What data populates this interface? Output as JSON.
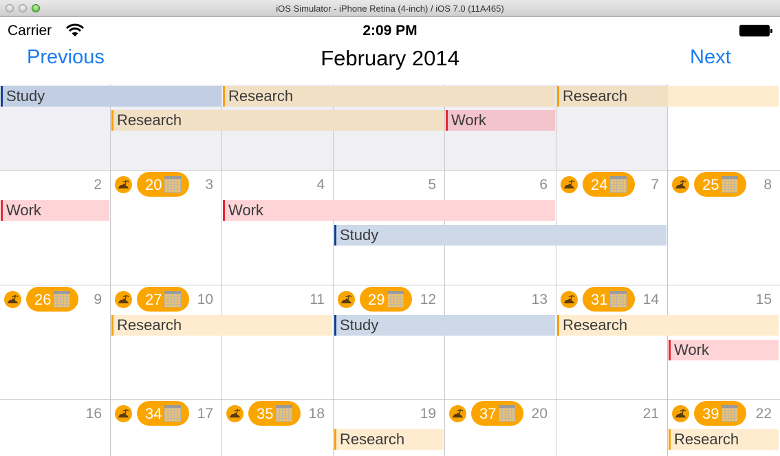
{
  "window": {
    "title": "iOS Simulator - iPhone Retina (4-inch) / iOS 7.0 (11A465)"
  },
  "status_bar": {
    "carrier": "Carrier",
    "time": "2:09 PM",
    "wifi_icon": "wifi-icon",
    "battery_icon": "battery-icon"
  },
  "nav": {
    "previous_label": "Previous",
    "title": "February 2014",
    "next_label": "Next"
  },
  "colors": {
    "accent": "#1a7cf0",
    "badge": "#fba500",
    "study": "#0c3e91",
    "research": "#f6a00f",
    "work": "#e8232e",
    "outside_month_bg": "#efeff4"
  },
  "weeks": [
    {
      "days": [
        {
          "num": "",
          "outside": true
        },
        {
          "num": "",
          "outside": true
        },
        {
          "num": "",
          "outside": true
        },
        {
          "num": "",
          "outside": true
        },
        {
          "num": "",
          "outside": true
        },
        {
          "num": "",
          "outside": true
        },
        {
          "num": "",
          "outside": false
        }
      ],
      "events": [
        {
          "label": "Study",
          "type": "study",
          "start": 0,
          "end": 1,
          "lane": 0,
          "segments_dim": [
            0,
            1
          ]
        },
        {
          "label": "Research",
          "type": "research",
          "start": 2,
          "end": 4,
          "lane": 0,
          "segments_dim": [
            2,
            3,
            4
          ]
        },
        {
          "label": "Research",
          "type": "research",
          "start": 5,
          "end": 6,
          "lane": 0,
          "segments_dim": [
            5
          ]
        },
        {
          "label": "Research",
          "type": "research",
          "start": 1,
          "end": 3,
          "lane": 1,
          "segments_dim": [
            1,
            2,
            3
          ]
        },
        {
          "label": "Work",
          "type": "work",
          "start": 4,
          "end": 4,
          "lane": 1,
          "segments_dim": [
            4
          ]
        }
      ]
    },
    {
      "days": [
        {
          "num": "2"
        },
        {
          "num": "3",
          "badge": "20"
        },
        {
          "num": "4"
        },
        {
          "num": "5"
        },
        {
          "num": "6"
        },
        {
          "num": "7",
          "badge": "24"
        },
        {
          "num": "8",
          "badge": "25"
        }
      ],
      "events": [
        {
          "label": "Work",
          "type": "work",
          "start": 0,
          "end": 0,
          "lane": 0
        },
        {
          "label": "Work",
          "type": "work",
          "start": 2,
          "end": 4,
          "lane": 0
        },
        {
          "label": "Study",
          "type": "study",
          "start": 3,
          "end": 5,
          "lane": 1
        }
      ]
    },
    {
      "days": [
        {
          "num": "9",
          "badge": "26"
        },
        {
          "num": "10",
          "badge": "27"
        },
        {
          "num": "11"
        },
        {
          "num": "12",
          "badge": "29"
        },
        {
          "num": "13"
        },
        {
          "num": "14",
          "badge": "31"
        },
        {
          "num": "15"
        }
      ],
      "events": [
        {
          "label": "Research",
          "type": "research",
          "start": 1,
          "end": 2,
          "lane": 0
        },
        {
          "label": "Study",
          "type": "study",
          "start": 3,
          "end": 4,
          "lane": 0
        },
        {
          "label": "Research",
          "type": "research",
          "start": 5,
          "end": 6,
          "lane": 0
        },
        {
          "label": "Work",
          "type": "work",
          "start": 6,
          "end": 6,
          "lane": 1
        }
      ]
    },
    {
      "days": [
        {
          "num": "16"
        },
        {
          "num": "17",
          "badge": "34"
        },
        {
          "num": "18",
          "badge": "35"
        },
        {
          "num": "19"
        },
        {
          "num": "20",
          "badge": "37"
        },
        {
          "num": "21"
        },
        {
          "num": "22",
          "badge": "39"
        }
      ],
      "events": [
        {
          "label": "Research",
          "type": "research",
          "start": 3,
          "end": 3,
          "lane": 0
        },
        {
          "label": "Research",
          "type": "research",
          "start": 6,
          "end": 6,
          "lane": 0
        }
      ]
    }
  ]
}
